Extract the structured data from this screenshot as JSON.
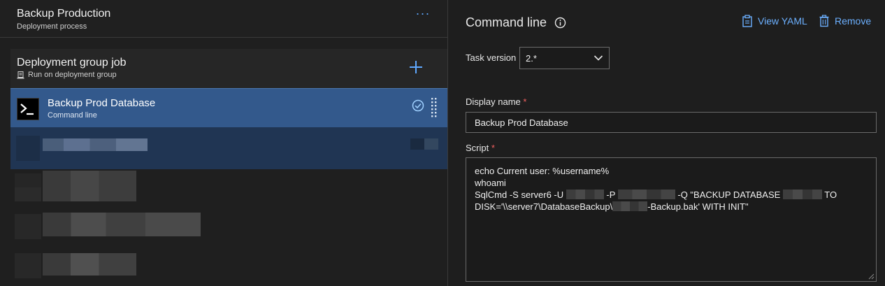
{
  "pipeline": {
    "title": "Backup Production",
    "subtitle": "Deployment process",
    "more_label": "···"
  },
  "job": {
    "title": "Deployment group job",
    "subtitle": "Run on deployment group"
  },
  "selected_task": {
    "title": "Backup Prod Database",
    "subtitle": "Command line"
  },
  "panel": {
    "title": "Command line",
    "view_yaml_label": "View YAML",
    "remove_label": "Remove",
    "task_version_label": "Task version",
    "task_version_value": "2.*",
    "display_name_label": "Display name",
    "required_mark": "*",
    "display_name_value": "Backup Prod Database",
    "script_label": "Script",
    "script": {
      "line1": "echo Current user: %username%",
      "line2": "whoami",
      "line3_part1": "SqlCmd -S server6 -U ",
      "line3_part2": " -P ",
      "line3_part3": " -Q \"BACKUP DATABASE ",
      "line3_part4": " TO",
      "line4_part1": "DISK='\\\\server7\\DatabaseBackup\\",
      "line4_part2": "-Backup.bak' WITH INIT\""
    }
  },
  "colors": {
    "accent": "#5fa8ff",
    "selected_row": "#33598c",
    "required": "#f0605f"
  }
}
